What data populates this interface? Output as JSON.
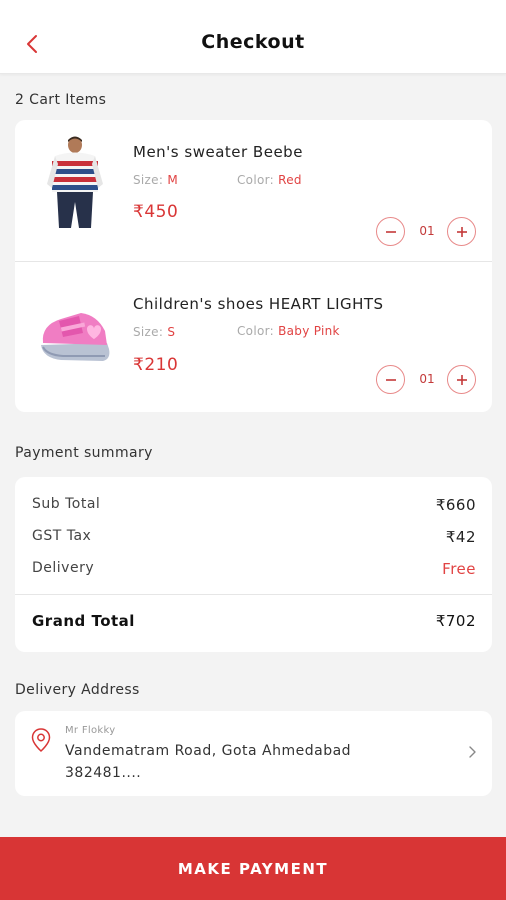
{
  "header": {
    "title": "Checkout"
  },
  "cart": {
    "label": "2 Cart Items",
    "items": [
      {
        "name": "Men's sweater Beebe",
        "size_label": "Size:",
        "size": "M",
        "color_label": "Color:",
        "color": "Red",
        "price": "₹450",
        "qty": "01"
      },
      {
        "name": "Children's shoes HEART LIGHTS",
        "size_label": "Size:",
        "size": "S",
        "color_label": "Color:",
        "color": "Baby Pink",
        "price": "₹210",
        "qty": "01"
      }
    ]
  },
  "payment": {
    "label": "Payment summary",
    "rows": [
      {
        "label": "Sub Total",
        "value": "₹660"
      },
      {
        "label": "GST Tax",
        "value": "₹42"
      },
      {
        "label": "Delivery",
        "value": "Free"
      }
    ],
    "grand_label": "Grand Total",
    "grand_value": "₹702"
  },
  "address": {
    "label": "Delivery Address",
    "name": "Mr Flokky",
    "line1": "Vandematram Road, Gota Ahmedabad",
    "line2": "382481...."
  },
  "cta": {
    "label": "MAKE PAYMENT"
  },
  "icons": {
    "back": "chevron-left-icon",
    "minus": "minus-icon",
    "plus": "plus-icon",
    "location": "location-pin-icon",
    "chevron": "chevron-right-icon"
  },
  "colors": {
    "accent": "#d83535",
    "background": "#f3f3f3",
    "card": "#ffffff"
  }
}
